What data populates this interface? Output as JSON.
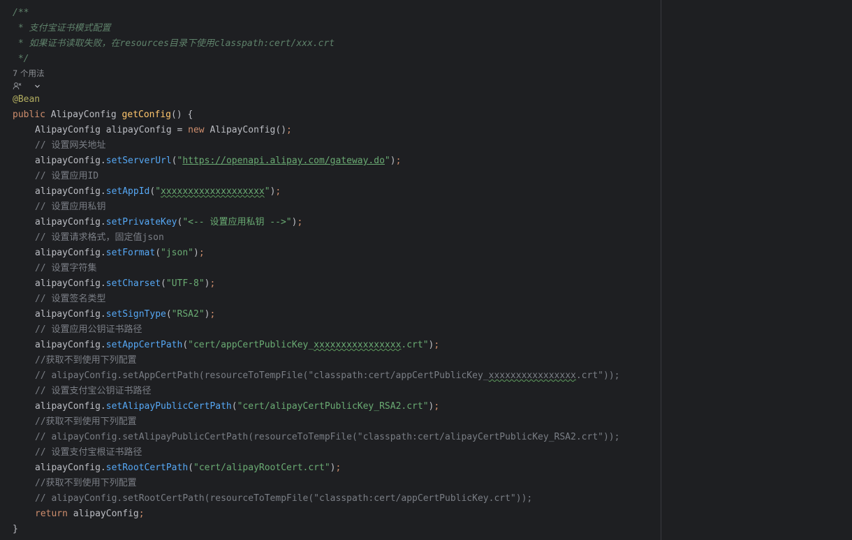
{
  "javadoc": {
    "open": "/**",
    "line1": " * 支付宝证书模式配置",
    "line2": " * 如果证书读取失败，在resources目录下使用classpath:cert/xxx.crt",
    "close": " */"
  },
  "usages_hint": "7 个用法",
  "annotation": "@Bean",
  "method": {
    "modifier": "public",
    "return_type": "AlipayConfig",
    "name": "getConfig",
    "params_open": "() {",
    "close_brace": "}"
  },
  "body": {
    "decl_type": "AlipayConfig",
    "decl_var": "alipayConfig",
    "decl_eq": " = ",
    "decl_new": "new",
    "decl_ctor": "AlipayConfig",
    "decl_end": "()",
    "semicolon": ";",
    "obj": "alipayConfig",
    "c_gateway": "// 设置网关地址",
    "m_server": "setServerUrl",
    "v_server": "https://openapi.alipay.com/gateway.do",
    "c_appid": "// 设置应用ID",
    "m_appid": "setAppId",
    "v_appid": "xxxxxxxxxxxxxxxxxxx",
    "c_privkey": "// 设置应用私钥",
    "m_privkey": "setPrivateKey",
    "v_privkey": "<-- 设置应用私钥 -->",
    "c_format": "// 设置请求格式，固定值json",
    "m_format": "setFormat",
    "v_format": "json",
    "c_charset": "// 设置字符集",
    "m_charset": "setCharset",
    "v_charset": "UTF-8",
    "c_signtype": "// 设置签名类型",
    "m_signtype": "setSignType",
    "v_signtype": "RSA2",
    "c_appcert": "// 设置应用公钥证书路径",
    "m_appcert": "setAppCertPath",
    "v_appcert_a": "cert/appCertPublicKey_",
    "v_appcert_x": "xxxxxxxxxxxxxxxx",
    "v_appcert_b": ".crt",
    "c_fallback": "//获取不到使用下列配置",
    "c_appcert_alt_a": "// alipayConfig.setAppCertPath(resourceToTempFile(\"classpath:cert/appCertPublicKey_",
    "c_appcert_alt_x": "xxxxxxxxxxxxxxxx",
    "c_appcert_alt_b": ".crt\"));",
    "c_alicert": "// 设置支付宝公钥证书路径",
    "m_alicert": "setAlipayPublicCertPath",
    "v_alicert": "cert/alipayCertPublicKey_RSA2.crt",
    "c_alicert_alt": "// alipayConfig.setAlipayPublicCertPath(resourceToTempFile(\"classpath:cert/alipayCertPublicKey_RSA2.crt\"));",
    "c_rootcert": "// 设置支付宝根证书路径",
    "m_rootcert": "setRootCertPath",
    "v_rootcert": "cert/alipayRootCert.crt",
    "c_rootcert_alt": "// alipayConfig.setRootCertPath(resourceToTempFile(\"classpath:cert/appCertPublicKey.crt\"));",
    "ret_kw": "return",
    "ret_var": "alipayConfig"
  },
  "colors": {
    "background": "#1e1f22",
    "keyword": "#cf8e6d",
    "string": "#6aab73",
    "method_call": "#56a8f5",
    "method_decl": "#ffc66d",
    "annotation": "#b3ae60",
    "comment": "#7a7e85",
    "doc_comment": "#5f826b"
  },
  "icons": {
    "author_hint": "contributor-icon",
    "expand": "chevron-down-icon"
  }
}
